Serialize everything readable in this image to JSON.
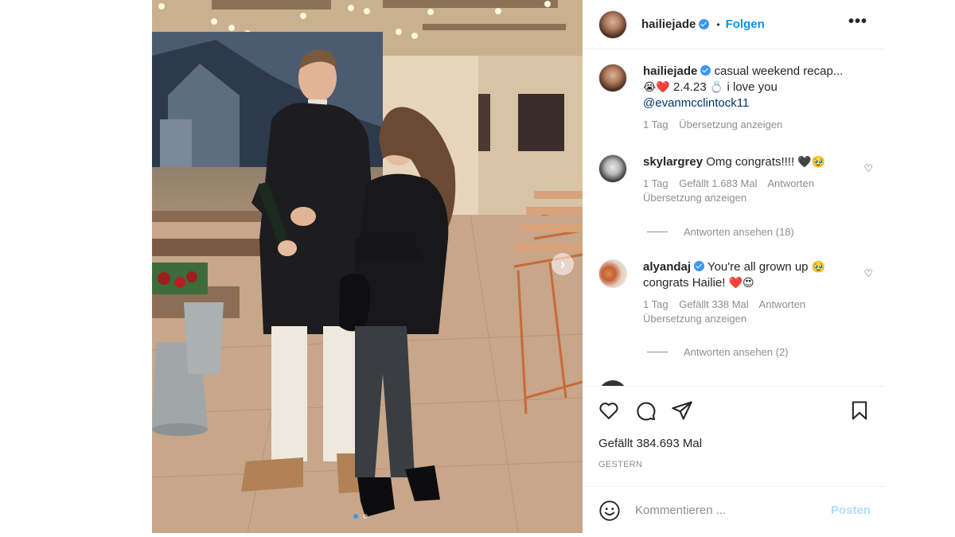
{
  "header": {
    "username": "hailiejade",
    "separator": "•",
    "follow_label": "Folgen",
    "more_glyph": "•••"
  },
  "caption": {
    "username": "hailiejade",
    "text_line1": "casual weekend recap...",
    "emoji1": "😭❤️",
    "text_date": "2.4.23",
    "emoji2": "💍",
    "text_love": "i love you",
    "mention": "@evanmcclintock11",
    "time": "1 Tag",
    "translate": "Übersetzung anzeigen"
  },
  "comments": [
    {
      "username": "skylargrey",
      "text": "Omg congrats!!!!",
      "emoji": "🖤🥹",
      "time": "1 Tag",
      "likes": "Gefällt 1.683 Mal",
      "reply": "Antworten",
      "translate": "Übersetzung anzeigen",
      "view_replies": "Antworten ansehen (18)"
    },
    {
      "username": "alyandaj",
      "text_line1": "You're all grown up",
      "emoji1": "🥹",
      "text_line2": "congrats Hailie!",
      "emoji2": "❤️😍",
      "time": "1 Tag",
      "likes": "Gefällt 338 Mal",
      "reply": "Antworten",
      "translate": "Übersetzung anzeigen",
      "view_replies": "Antworten ansehen (2)"
    }
  ],
  "actions": {
    "like_icon": "heart-icon",
    "comment_icon": "comment-bubble-icon",
    "share_icon": "paper-plane-icon",
    "save_icon": "bookmark-icon"
  },
  "likes_text": "Gefällt 384.693 Mal",
  "date_text": "GESTERN",
  "composer": {
    "placeholder": "Kommentieren ...",
    "post_label": "Posten"
  },
  "carousel": {
    "next_glyph": "›",
    "dot_count": 2,
    "active_dot": 1
  },
  "colors": {
    "accent": "#0095f6",
    "verified": "#3897f0",
    "muted": "#8e8e8e",
    "post_disabled": "#b2dffc"
  }
}
